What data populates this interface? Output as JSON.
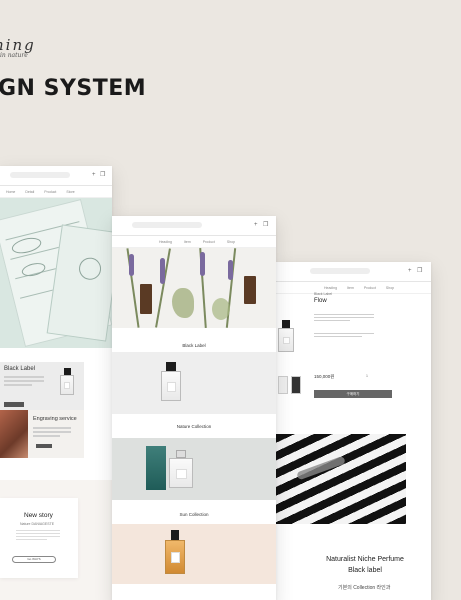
{
  "brand": {
    "script": "ning",
    "tagline": "in nature",
    "title": "GN SYSTEM"
  },
  "left_window": {
    "menu": [
      "Home",
      "Detail",
      "Product",
      "Store"
    ],
    "black_label": "Black Label",
    "engraving": "Engraving service",
    "story_title": "New story",
    "story_sub": "Nature DANIAGESTE",
    "story_button": "Go WAYS"
  },
  "mid_window": {
    "menu": [
      "Heading",
      "Item",
      "Product",
      "Shop"
    ],
    "section_black": "Black Label",
    "section_nature": "Nature Collection",
    "section_sun": "Sun Collection"
  },
  "right_window": {
    "small": "Black Label",
    "title": "Flow",
    "price": "150,000원",
    "qty": "1",
    "buy_button": "구매하기",
    "footer_title": "Naturalist Niche Perfume",
    "footer_sub": "Black label",
    "footer_kr": "기본의 Collection 라인과"
  },
  "colors": {
    "background": "#ebe7e1",
    "window": "#ffffff",
    "mint": "#d9e7e1"
  }
}
